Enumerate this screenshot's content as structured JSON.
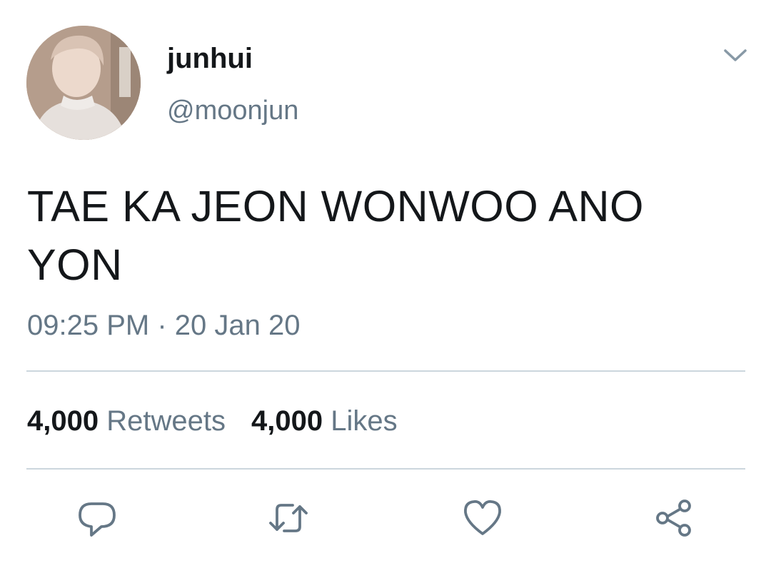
{
  "tweet": {
    "author": {
      "display_name": "junhui",
      "handle": "@moonjun",
      "avatar_icon": "profile-photo"
    },
    "text": "TAE KA JEON WONWOO ANO YON",
    "time": "09:25 PM",
    "separator": "·",
    "date": "20 Jan 20",
    "stats": {
      "retweets_count": "4,000",
      "retweets_label": "Retweets",
      "likes_count": "4,000",
      "likes_label": "Likes"
    },
    "actions": [
      "reply-icon",
      "retweet-icon",
      "like-icon",
      "share-icon"
    ],
    "menu_icon": "chevron-down-icon"
  },
  "colors": {
    "text_primary": "#14171a",
    "text_secondary": "#657786",
    "divider": "#ccd6dd",
    "icon": "#657786"
  }
}
